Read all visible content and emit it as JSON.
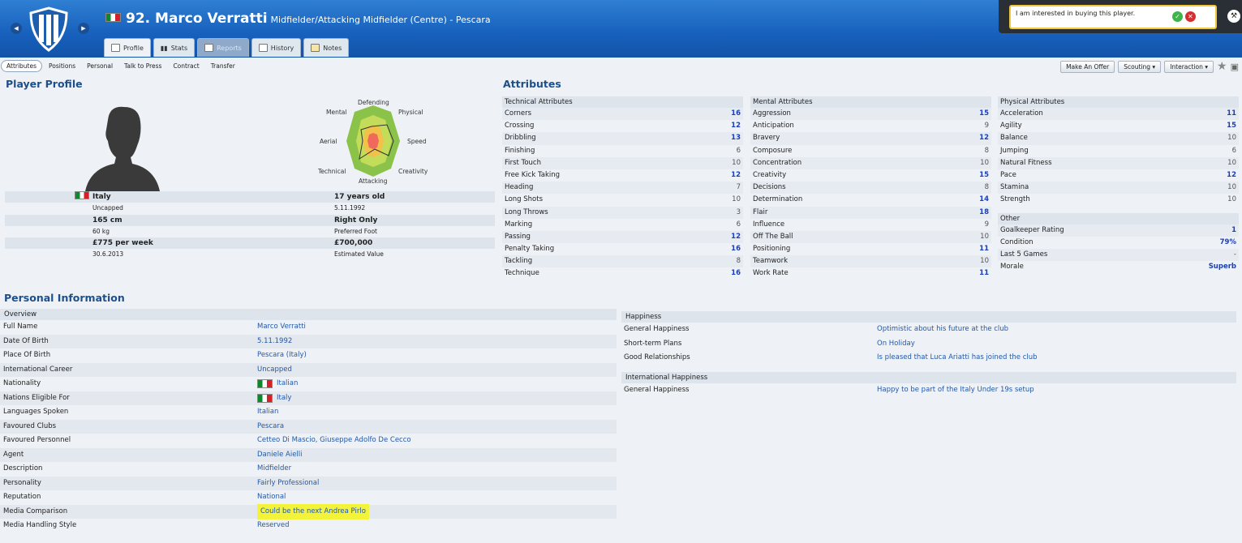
{
  "header": {
    "player_number_name": "92. Marco Verratti",
    "subtitle": "Midfielder/Attacking Midfielder (Centre) - Pescara",
    "tabs": [
      "Profile",
      "Stats",
      "Reports",
      "History",
      "Notes"
    ]
  },
  "notification": {
    "text": "I am interested in buying this player."
  },
  "subnav": [
    "Attributes",
    "Positions",
    "Personal",
    "Talk to Press",
    "Contract",
    "Transfer"
  ],
  "actions": {
    "offer": "Make An Offer",
    "scouting": "Scouting ▾",
    "interaction": "Interaction ▾"
  },
  "profile": {
    "heading": "Player Profile",
    "radar_labels": {
      "defending": "Defending",
      "physical": "Physical",
      "speed": "Speed",
      "creativity": "Creativity",
      "attacking": "Attacking",
      "technical": "Technical",
      "aerial": "Aerial",
      "mental": "Mental"
    },
    "rows": [
      {
        "left": "Italy",
        "right": "17 years old",
        "strong": true
      },
      {
        "left": "Uncapped",
        "right": "5.11.1992",
        "strong": false
      },
      {
        "left": "165 cm",
        "right": "Right Only",
        "strong": true
      },
      {
        "left": "60 kg",
        "right": "Preferred Foot",
        "strong": false
      },
      {
        "left": "£775 per week",
        "right": "£700,000",
        "strong": true
      },
      {
        "left": "30.6.2013",
        "right": "Estimated Value",
        "strong": false
      }
    ]
  },
  "attributes": {
    "heading": "Attributes",
    "technical": {
      "title": "Technical Attributes",
      "items": [
        {
          "name": "Corners",
          "value": "16",
          "hi": true
        },
        {
          "name": "Crossing",
          "value": "12",
          "hi": true
        },
        {
          "name": "Dribbling",
          "value": "13",
          "hi": true
        },
        {
          "name": "Finishing",
          "value": "6",
          "hi": false
        },
        {
          "name": "First Touch",
          "value": "10",
          "hi": false
        },
        {
          "name": "Free Kick Taking",
          "value": "12",
          "hi": true
        },
        {
          "name": "Heading",
          "value": "7",
          "hi": false
        },
        {
          "name": "Long Shots",
          "value": "10",
          "hi": false
        },
        {
          "name": "Long Throws",
          "value": "3",
          "hi": false
        },
        {
          "name": "Marking",
          "value": "6",
          "hi": false
        },
        {
          "name": "Passing",
          "value": "12",
          "hi": true
        },
        {
          "name": "Penalty Taking",
          "value": "16",
          "hi": true
        },
        {
          "name": "Tackling",
          "value": "8",
          "hi": false
        },
        {
          "name": "Technique",
          "value": "16",
          "hi": true
        }
      ]
    },
    "mental": {
      "title": "Mental Attributes",
      "items": [
        {
          "name": "Aggression",
          "value": "15",
          "hi": true
        },
        {
          "name": "Anticipation",
          "value": "9",
          "hi": false
        },
        {
          "name": "Bravery",
          "value": "12",
          "hi": true
        },
        {
          "name": "Composure",
          "value": "8",
          "hi": false
        },
        {
          "name": "Concentration",
          "value": "10",
          "hi": false
        },
        {
          "name": "Creativity",
          "value": "15",
          "hi": true
        },
        {
          "name": "Decisions",
          "value": "8",
          "hi": false
        },
        {
          "name": "Determination",
          "value": "14",
          "hi": true
        },
        {
          "name": "Flair",
          "value": "18",
          "hi": true
        },
        {
          "name": "Influence",
          "value": "9",
          "hi": false
        },
        {
          "name": "Off The Ball",
          "value": "10",
          "hi": false
        },
        {
          "name": "Positioning",
          "value": "11",
          "hi": true
        },
        {
          "name": "Teamwork",
          "value": "10",
          "hi": false
        },
        {
          "name": "Work Rate",
          "value": "11",
          "hi": true
        }
      ]
    },
    "physical": {
      "title": "Physical Attributes",
      "items": [
        {
          "name": "Acceleration",
          "value": "11",
          "hi": true
        },
        {
          "name": "Agility",
          "value": "15",
          "hi": true
        },
        {
          "name": "Balance",
          "value": "10",
          "hi": false
        },
        {
          "name": "Jumping",
          "value": "6",
          "hi": false
        },
        {
          "name": "Natural Fitness",
          "value": "10",
          "hi": false
        },
        {
          "name": "Pace",
          "value": "12",
          "hi": true
        },
        {
          "name": "Stamina",
          "value": "10",
          "hi": false
        },
        {
          "name": "Strength",
          "value": "10",
          "hi": false
        }
      ]
    },
    "other": {
      "title": "Other",
      "items": [
        {
          "name": "Goalkeeper Rating",
          "value": "1",
          "hi": true
        },
        {
          "name": "Condition",
          "value": "79%",
          "hi": true
        },
        {
          "name": "Last 5 Games",
          "value": "-",
          "hi": false
        },
        {
          "name": "Morale",
          "value": "Superb",
          "hi": true
        }
      ]
    }
  },
  "personal": {
    "heading": "Personal Information",
    "overview_title": "Overview",
    "rows": [
      {
        "key": "Full Name",
        "value": "Marco Verratti",
        "flag": false,
        "highlight": false
      },
      {
        "key": "Date Of Birth",
        "value": "5.11.1992",
        "flag": false,
        "highlight": false
      },
      {
        "key": "Place Of Birth",
        "value": "Pescara (Italy)",
        "flag": false,
        "highlight": false
      },
      {
        "key": "International Career",
        "value": "Uncapped",
        "flag": false,
        "highlight": false
      },
      {
        "key": "Nationality",
        "value": "Italian",
        "flag": true,
        "highlight": false
      },
      {
        "key": "Nations Eligible For",
        "value": "Italy",
        "flag": true,
        "highlight": false
      },
      {
        "key": "Languages Spoken",
        "value": "Italian",
        "flag": false,
        "highlight": false
      },
      {
        "key": "Favoured Clubs",
        "value": "Pescara",
        "flag": false,
        "highlight": false
      },
      {
        "key": "Favoured Personnel",
        "value": "Cetteo Di Mascio, Giuseppe Adolfo De Cecco",
        "flag": false,
        "highlight": false
      },
      {
        "key": "Agent",
        "value": "Daniele Aielli",
        "flag": false,
        "highlight": false
      },
      {
        "key": "Description",
        "value": "Midfielder",
        "flag": false,
        "highlight": false
      },
      {
        "key": "Personality",
        "value": "Fairly Professional",
        "flag": false,
        "highlight": false
      },
      {
        "key": "Reputation",
        "value": "National",
        "flag": false,
        "highlight": false
      },
      {
        "key": "Media Comparison",
        "value": "Could be the next Andrea Pirlo",
        "flag": false,
        "highlight": true
      },
      {
        "key": "Media Handling Style",
        "value": "Reserved",
        "flag": false,
        "highlight": false
      }
    ]
  },
  "happiness": {
    "title": "Happiness",
    "rows": [
      {
        "key": "General Happiness",
        "value": "Optimistic about his future at the club"
      },
      {
        "key": "Short-term Plans",
        "value": "On Holiday"
      },
      {
        "key": "Good Relationships",
        "value": "Is pleased that Luca Ariatti has joined the club"
      }
    ],
    "intl_title": "International Happiness",
    "intl_rows": [
      {
        "key": "General Happiness",
        "value": "Happy to be part of the Italy Under 19s setup"
      }
    ]
  }
}
